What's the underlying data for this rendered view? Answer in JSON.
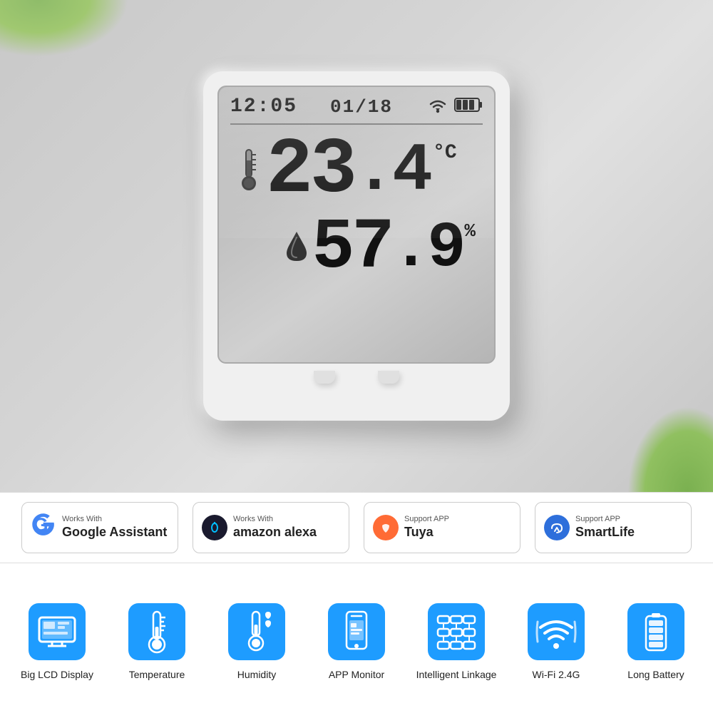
{
  "device": {
    "time": "12:05",
    "date": "01/18",
    "temperature": "23",
    "temp_decimal": ".4",
    "temp_unit": "°C",
    "humidity": "57",
    "hum_decimal": ".9",
    "hum_unit": "%"
  },
  "badges": [
    {
      "id": "google",
      "works_with_label": "Works With",
      "brand": "Google Assistant",
      "icon_type": "google"
    },
    {
      "id": "alexa",
      "works_with_label": "Works With",
      "brand": "amazon alexa",
      "icon_type": "alexa"
    },
    {
      "id": "tuya",
      "works_with_label": "Support APP",
      "brand": "Tuya",
      "icon_type": "tuya"
    },
    {
      "id": "smartlife",
      "works_with_label": "Support APP",
      "brand": "SmartLife",
      "icon_type": "smartlife"
    }
  ],
  "features": [
    {
      "id": "lcd",
      "label": "Big LCD Display",
      "icon": "lcd"
    },
    {
      "id": "temperature",
      "label": "Temperature",
      "icon": "thermometer"
    },
    {
      "id": "humidity",
      "label": "Humidity",
      "icon": "humidity"
    },
    {
      "id": "app",
      "label": "APP Monitor",
      "icon": "phone"
    },
    {
      "id": "linkage",
      "label": "Intelligent Linkage",
      "icon": "linkage"
    },
    {
      "id": "wifi",
      "label": "Wi-Fi 2.4G",
      "icon": "wifi"
    },
    {
      "id": "battery",
      "label": "Long Battery",
      "icon": "battery"
    }
  ]
}
